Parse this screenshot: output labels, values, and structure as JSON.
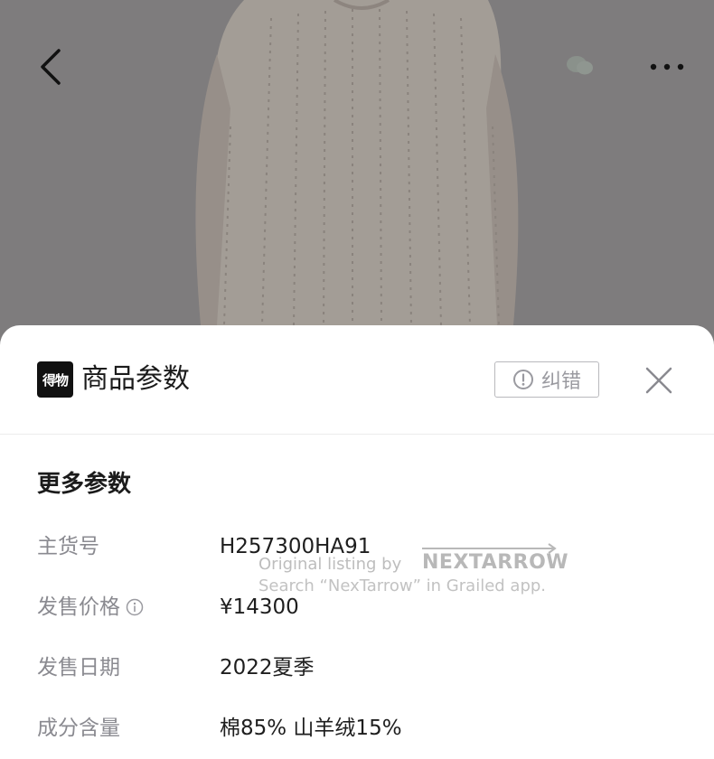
{
  "header": {
    "back_icon": "chevron-left-icon",
    "share_icon": "wechat-icon",
    "more_icon": "more-dots-icon"
  },
  "sheet": {
    "brand_logo_text": "得物",
    "title": "商品参数",
    "report_label": "纠错",
    "section_title": "更多参数",
    "params": [
      {
        "label": "主货号",
        "value": "H257300HA91",
        "info": false
      },
      {
        "label": "发售价格",
        "value": "¥14300",
        "info": true
      },
      {
        "label": "发售日期",
        "value": "2022夏季",
        "info": false
      },
      {
        "label": "成分含量",
        "value": "棉85% 山羊绒15%",
        "info": false
      }
    ]
  },
  "watermark": {
    "line1": "Original listing by",
    "brand": "NEXTARROW",
    "line2": "Search “NexTarrow” in Grailed app."
  },
  "colors": {
    "overlay": "#7d7b7c",
    "sheet_bg": "#ffffff",
    "label_gray": "#8a8a90"
  }
}
